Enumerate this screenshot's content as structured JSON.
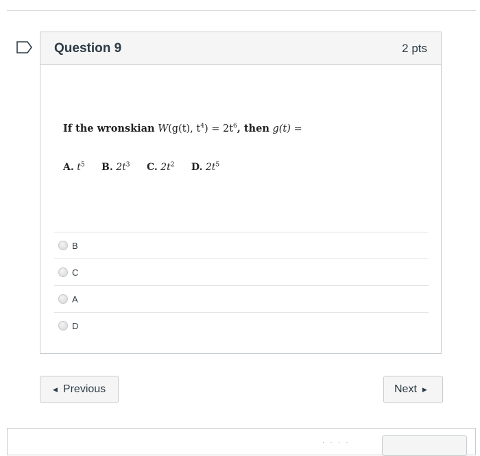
{
  "question": {
    "title": "Question 9",
    "points": "2 pts",
    "text_prefix": "If the wronskian",
    "text_w": "W",
    "text_args": "(g(t), t",
    "text_args_exp": "4",
    "text_eq": ") = 2t",
    "text_eq_exp": "6",
    "text_then": ", then",
    "text_gt": "g(t) =",
    "choices": [
      {
        "letter": "A.",
        "base": "t",
        "exp": "5"
      },
      {
        "letter": "B.",
        "base": "2t",
        "exp": "3"
      },
      {
        "letter": "C.",
        "base": "2t",
        "exp": "2"
      },
      {
        "letter": "D.",
        "base": "2t",
        "exp": "5"
      }
    ]
  },
  "answers": [
    {
      "label": "B"
    },
    {
      "label": "C"
    },
    {
      "label": "A"
    },
    {
      "label": "D"
    }
  ],
  "nav": {
    "previous_label": "Previous",
    "next_label": "Next"
  },
  "colors": {
    "border": "#c7cdd1",
    "header_bg": "#f5f5f5",
    "text": "#2d3b45"
  }
}
